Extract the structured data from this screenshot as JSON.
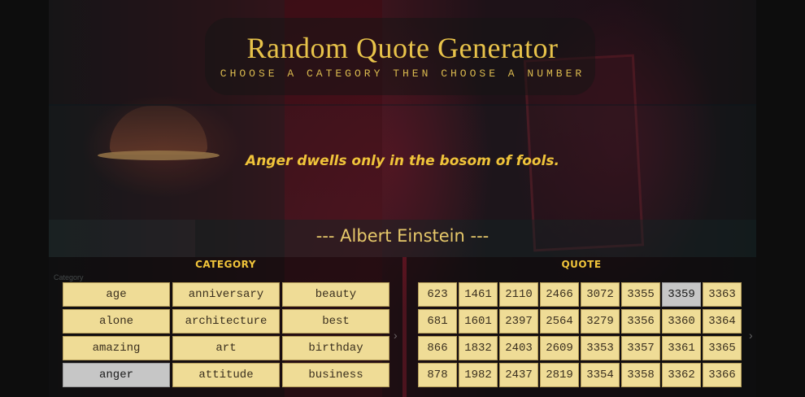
{
  "header": {
    "title": "Random Quote Generator",
    "subtitle": "CHOOSE A CATEGORY THEN CHOOSE A NUMBER"
  },
  "quote": {
    "text": "Anger dwells only in the bosom of fools.",
    "author": "--- Albert Einstein ---"
  },
  "panels": {
    "category_label": "CATEGORY",
    "quote_label": "QUOTE",
    "ghost_label": "Category"
  },
  "categories": [
    "age",
    "anniversary",
    "beauty",
    "alone",
    "architecture",
    "best",
    "amazing",
    "art",
    "birthday",
    "anger",
    "attitude",
    "business"
  ],
  "selected_category": "anger",
  "numbers": [
    "623",
    "1461",
    "2110",
    "2466",
    "3072",
    "3355",
    "3359",
    "3363",
    "681",
    "1601",
    "2397",
    "2564",
    "3279",
    "3356",
    "3360",
    "3364",
    "866",
    "1832",
    "2403",
    "2609",
    "3353",
    "3357",
    "3361",
    "3365",
    "878",
    "1982",
    "2437",
    "2819",
    "3354",
    "3358",
    "3362",
    "3366"
  ],
  "selected_number": "3359",
  "icons": {
    "prev": "chevron-right-icon",
    "next": "chevron-right-icon"
  },
  "colors": {
    "accent": "#f0c43a",
    "cell": "#efdc96",
    "selected": "#c6c6c6"
  }
}
